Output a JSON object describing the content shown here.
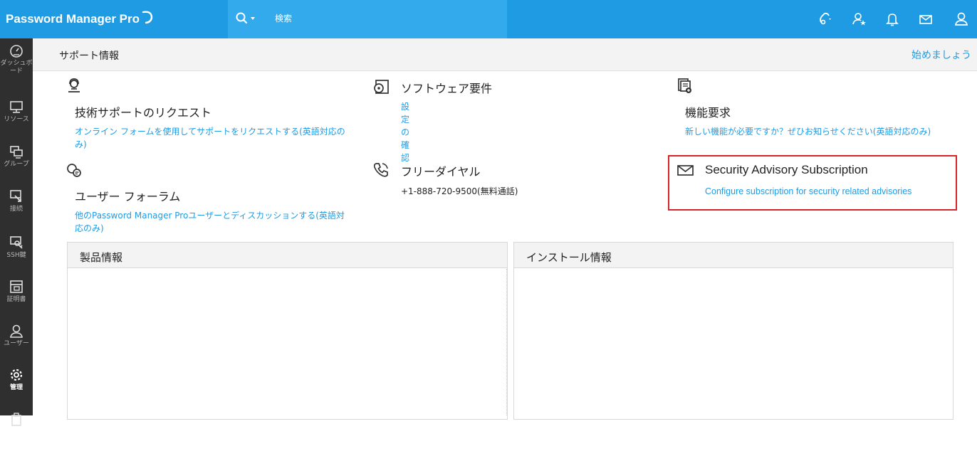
{
  "header": {
    "brand": "Password Manager Pro",
    "search_placeholder": "検索",
    "icons": [
      "remote-connection-icon",
      "user-star-icon",
      "bell-icon",
      "mail-icon",
      "user-profile-icon"
    ]
  },
  "sidebar": {
    "items": [
      {
        "label": "ダッシュボード",
        "icon": "dashboard-icon"
      },
      {
        "label": "リソース",
        "icon": "monitor-icon"
      },
      {
        "label": "グループ",
        "icon": "group-icon"
      },
      {
        "label": "接続",
        "icon": "connection-icon"
      },
      {
        "label": "SSH鍵",
        "icon": "ssh-key-icon"
      },
      {
        "label": "証明書",
        "icon": "certificate-icon"
      },
      {
        "label": "ユーザー",
        "icon": "user-icon"
      },
      {
        "label": "管理",
        "icon": "gear-icon"
      }
    ],
    "active": "管理"
  },
  "page": {
    "title": "サポート情報",
    "getting_started": "始めましょう"
  },
  "cards": {
    "tech_support": {
      "title": "技術サポートのリクエスト",
      "link": "オンライン フォームを使用してサポートをリクエストする(英語対応のみ)"
    },
    "software_req": {
      "title": "ソフトウェア要件",
      "link": "設定の確認"
    },
    "feature_request": {
      "title": "機能要求",
      "link": "新しい機能が必要ですか？ぜひお知らせください(英語対応のみ)"
    },
    "user_forum": {
      "title": "ユーザー フォーラム",
      "link": "他のPassword Manager Proユーザーとディスカッションする(英語対応のみ)"
    },
    "toll_free": {
      "title": "フリーダイヤル",
      "text": "+1-888-720-9500(無料通話)"
    },
    "security_advisory": {
      "title": "Security Advisory Subscription",
      "link": "Configure subscription for security related advisories"
    }
  },
  "panels": {
    "product_info": "製品情報",
    "install_info": "インストール情報"
  },
  "colors": {
    "topbar": "#1e9be3",
    "search_bg": "#33aaeb",
    "sidebar": "#2f2f2f",
    "link": "#1e9be3",
    "highlight": "#d9232a"
  }
}
